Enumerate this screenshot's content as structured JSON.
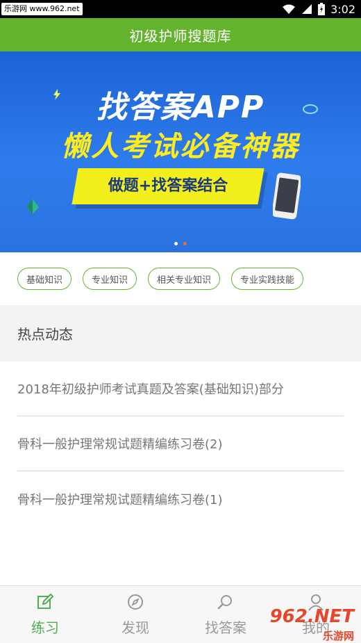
{
  "status_bar": {
    "watermark": "乐游网 www.962.net",
    "time": "3:02"
  },
  "header": {
    "title": "初级护师搜题库"
  },
  "banner": {
    "line1": "找答案APP",
    "line2": "懒人考试必备神器",
    "ribbon": "做题+找答案结合",
    "active_dot": 2,
    "colors": {
      "bg": "#2f7cec",
      "line2": "#ffec1f",
      "ribbon": "#f3ef1c"
    }
  },
  "categories": [
    {
      "label": "基础知识"
    },
    {
      "label": "专业知识"
    },
    {
      "label": "相关专业知识"
    },
    {
      "label": "专业实践技能"
    }
  ],
  "hot": {
    "title": "热点动态",
    "items": [
      {
        "title": "2018年初级护师考试真题及答案(基础知识)部分"
      },
      {
        "title": "骨科一般护理常规试题精编练习卷(2)"
      },
      {
        "title": "骨科一般护理常规试题精编练习卷(1)"
      }
    ]
  },
  "tabs": [
    {
      "label": "练习",
      "icon": "edit-icon",
      "active": true
    },
    {
      "label": "发现",
      "icon": "compass-icon",
      "active": false
    },
    {
      "label": "找答案",
      "icon": "search-icon",
      "active": false
    },
    {
      "label": "我的",
      "icon": "user-icon",
      "active": false
    }
  ],
  "watermark_br": {
    "brand": "962.NET",
    "site": "乐游网"
  },
  "colors": {
    "primary": "#63b32e",
    "tab_active": "#4caf50"
  }
}
